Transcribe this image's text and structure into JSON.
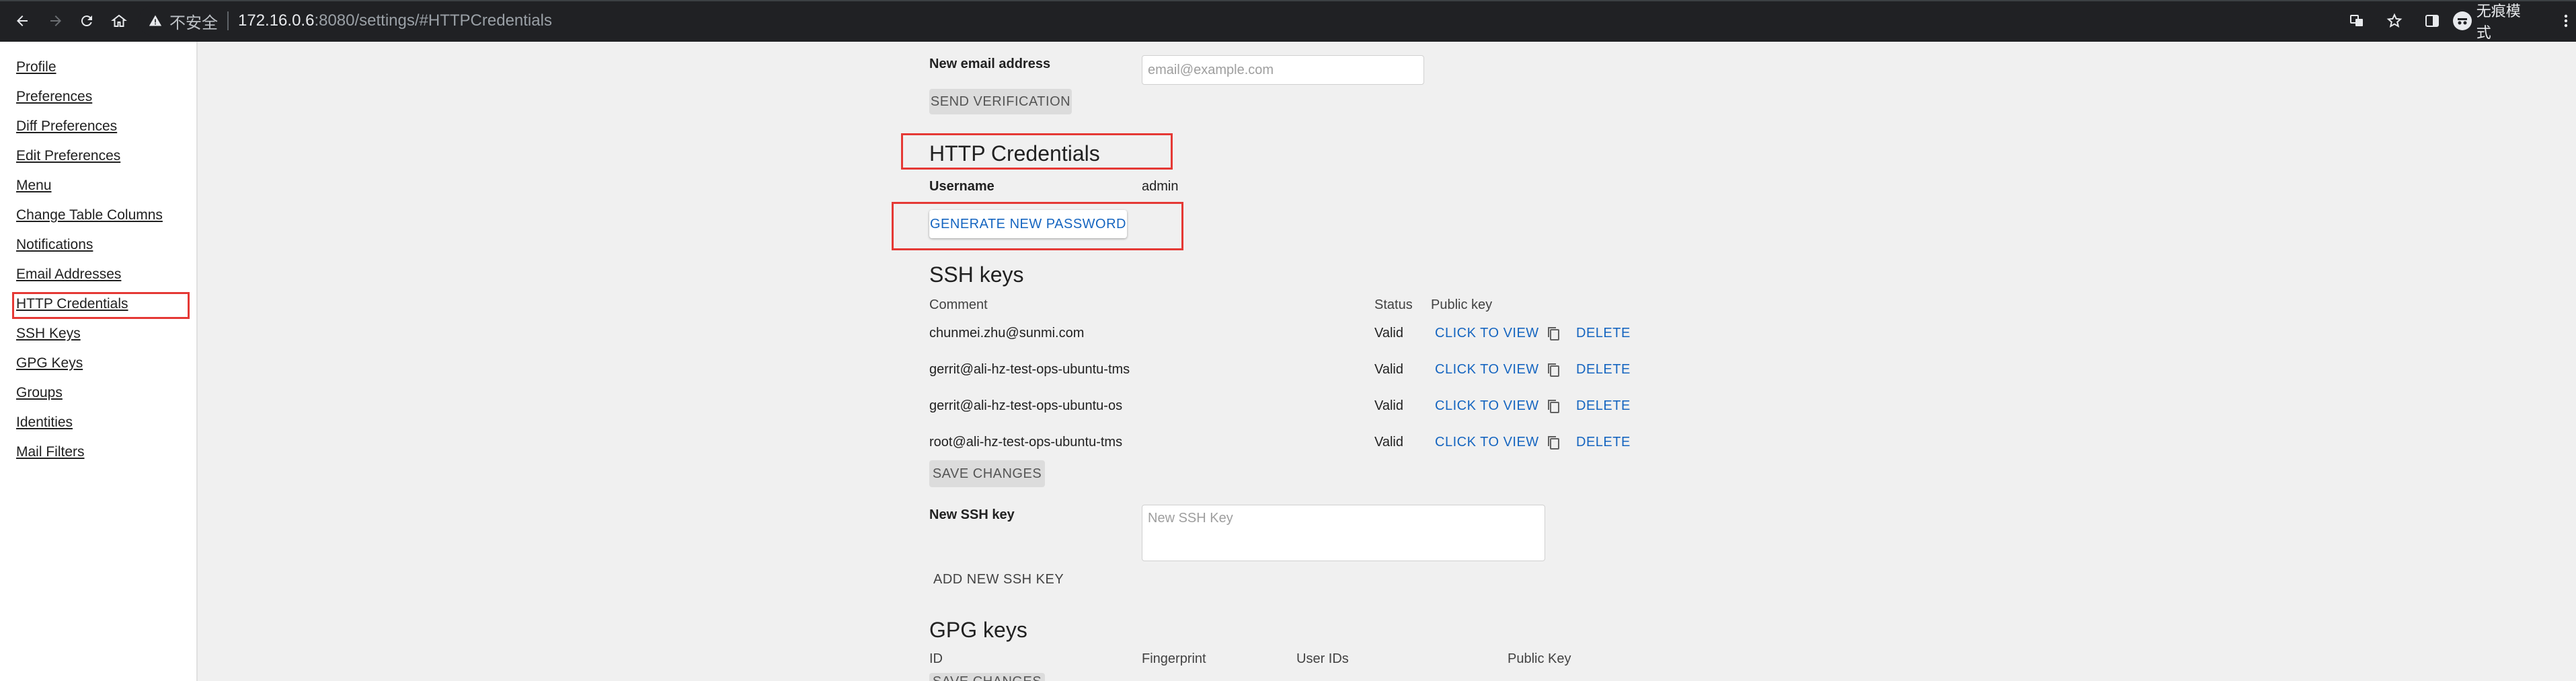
{
  "browser": {
    "insecure_label": "不安全",
    "url_host": "172.16.0.6",
    "url_path": ":8080/settings/#HTTPCredentials",
    "incognito_label": "无痕模式"
  },
  "sidebar": {
    "items": [
      {
        "label": "Profile"
      },
      {
        "label": "Preferences"
      },
      {
        "label": "Diff Preferences"
      },
      {
        "label": "Edit Preferences"
      },
      {
        "label": "Menu"
      },
      {
        "label": "Change Table Columns"
      },
      {
        "label": "Notifications"
      },
      {
        "label": "Email Addresses"
      },
      {
        "label": "HTTP Credentials"
      },
      {
        "label": "SSH Keys"
      },
      {
        "label": "GPG Keys"
      },
      {
        "label": "Groups"
      },
      {
        "label": "Identities"
      },
      {
        "label": "Mail Filters"
      }
    ]
  },
  "email": {
    "new_label": "New email address",
    "placeholder": "email@example.com",
    "send_button": "SEND VERIFICATION"
  },
  "http": {
    "title": "HTTP Credentials",
    "username_label": "Username",
    "username_value": "admin",
    "generate_button": "GENERATE NEW PASSWORD"
  },
  "ssh": {
    "title": "SSH keys",
    "columns": {
      "comment": "Comment",
      "status": "Status",
      "public_key": "Public key"
    },
    "rows": [
      {
        "comment": "chunmei.zhu@sunmi.com",
        "status": "Valid",
        "view": "CLICK TO VIEW",
        "delete": "DELETE"
      },
      {
        "comment": "gerrit@ali-hz-test-ops-ubuntu-tms",
        "status": "Valid",
        "view": "CLICK TO VIEW",
        "delete": "DELETE"
      },
      {
        "comment": "gerrit@ali-hz-test-ops-ubuntu-os",
        "status": "Valid",
        "view": "CLICK TO VIEW",
        "delete": "DELETE"
      },
      {
        "comment": "root@ali-hz-test-ops-ubuntu-tms",
        "status": "Valid",
        "view": "CLICK TO VIEW",
        "delete": "DELETE"
      }
    ],
    "save_button": "SAVE CHANGES",
    "new_key_label": "New SSH key",
    "new_key_placeholder": "New SSH Key",
    "add_button": "ADD NEW SSH KEY"
  },
  "gpg": {
    "title": "GPG keys",
    "columns": {
      "id": "ID",
      "fingerprint": "Fingerprint",
      "user_ids": "User IDs",
      "public_key": "Public Key"
    },
    "save_button": "SAVE CHANGES"
  },
  "colors": {
    "highlight": "#e53935",
    "link": "#1565c0",
    "page_bg": "#f0f0f0"
  }
}
